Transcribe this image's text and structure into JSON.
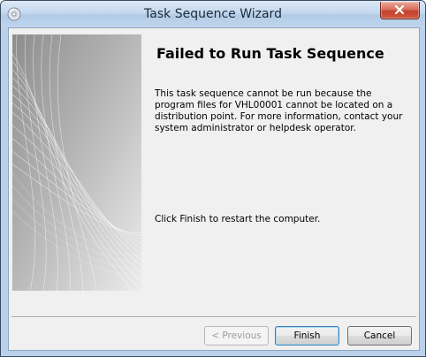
{
  "window": {
    "title": "Task Sequence Wizard",
    "close_label": "Close",
    "icon": "task-sequence-disc-icon"
  },
  "content": {
    "heading": "Failed to Run Task Sequence",
    "message": "This task sequence cannot be run because the program files for VHL00001 cannot be located on a distribution point. For more information, contact your system administrator or helpdesk operator.",
    "instruction": "Click Finish to restart the computer."
  },
  "buttons": {
    "previous": "< Previous",
    "finish": "Finish",
    "cancel": "Cancel"
  },
  "colors": {
    "client_background": "#f0f0f0",
    "close_button": "#c4402a",
    "default_button_border": "#3c7fb1"
  }
}
